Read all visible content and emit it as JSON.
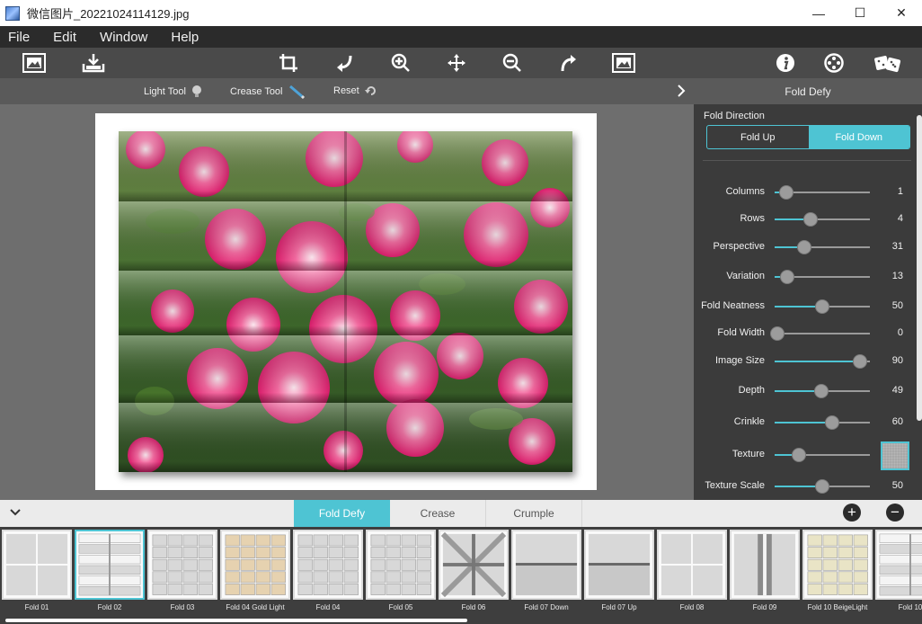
{
  "window": {
    "title": "微信图片_20221024114129.jpg",
    "minimize": "—",
    "maximize": "☐",
    "close": "✕"
  },
  "menu": [
    "File",
    "Edit",
    "Window",
    "Help"
  ],
  "subtoolbar": {
    "light_tool": "Light Tool",
    "crease_tool": "Crease Tool",
    "reset": "Reset"
  },
  "panel": {
    "title": "Fold Defy",
    "fold_direction_label": "Fold Direction",
    "fold_up": "Fold Up",
    "fold_down": "Fold Down",
    "sliders": [
      {
        "label": "Columns",
        "value": "1",
        "pos": 0.12
      },
      {
        "label": "Rows",
        "value": "4",
        "pos": 0.38
      },
      {
        "label": "Perspective",
        "value": "31",
        "pos": 0.31
      },
      {
        "label": "Variation",
        "value": "13",
        "pos": 0.13
      },
      {
        "label": "Fold Neatness",
        "value": "50",
        "pos": 0.5
      },
      {
        "label": "Fold Width",
        "value": "0",
        "pos": 0.03
      },
      {
        "label": "Image Size",
        "value": "90",
        "pos": 0.9
      },
      {
        "label": "Depth",
        "value": "49",
        "pos": 0.49
      },
      {
        "label": "Crinkle",
        "value": "60",
        "pos": 0.6
      },
      {
        "label": "Texture",
        "value": "",
        "pos": 0.25
      },
      {
        "label": "Texture Scale",
        "value": "50",
        "pos": 0.5
      }
    ]
  },
  "tabs": [
    "Fold Defy",
    "Crease",
    "Crumple"
  ],
  "presets": [
    {
      "name": "Fold 01",
      "style": "quad"
    },
    {
      "name": "Fold 02",
      "style": "bands"
    },
    {
      "name": "Fold 03",
      "style": "grid"
    },
    {
      "name": "Fold 04 Gold Light",
      "style": "gold"
    },
    {
      "name": "Fold 04",
      "style": "grid"
    },
    {
      "name": "Fold 05",
      "style": "grid"
    },
    {
      "name": "Fold 06",
      "style": "diag"
    },
    {
      "name": "Fold 07 Down",
      "style": "hfold"
    },
    {
      "name": "Fold 07 Up",
      "style": "hfold"
    },
    {
      "name": "Fold 08",
      "style": "quad"
    },
    {
      "name": "Fold 09",
      "style": "vert"
    },
    {
      "name": "Fold 10 BeigeLight",
      "style": "beige"
    },
    {
      "name": "Fold 10",
      "style": "bands"
    }
  ]
}
